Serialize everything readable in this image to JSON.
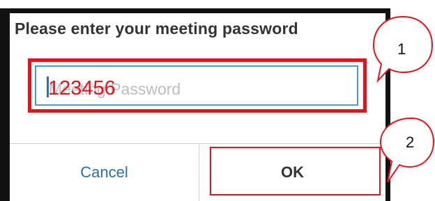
{
  "dialog": {
    "title": "Please enter your meeting password",
    "input": {
      "placeholder": "Meeting Password",
      "value": "123456"
    },
    "buttons": {
      "cancel": "Cancel",
      "ok": "OK"
    }
  },
  "annotations": {
    "callout_1": "1",
    "callout_2": "2",
    "color": "#e8101a"
  }
}
